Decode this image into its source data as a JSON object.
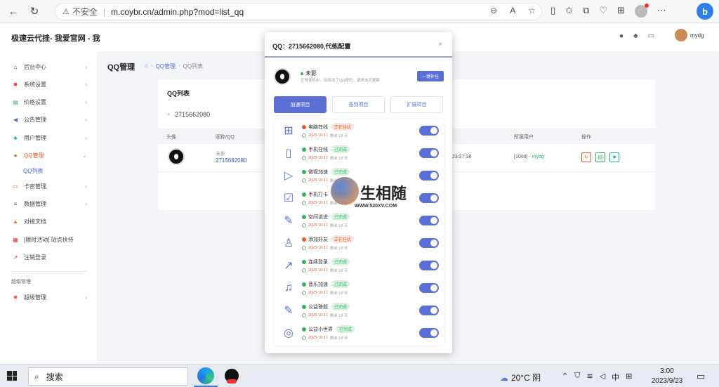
{
  "browser": {
    "insecure_label": "不安全",
    "url": "m.coybr.cn/admin.php?mod=list_qq"
  },
  "app": {
    "brand": "极速云代挂- 我爱官网 - 我",
    "user_name": "mydg"
  },
  "sidebar": {
    "items": [
      {
        "label": "后台中心"
      },
      {
        "label": "系统设置"
      },
      {
        "label": "价格设置"
      },
      {
        "label": "公告管理"
      },
      {
        "label": "用户管理"
      },
      {
        "label": "QQ管理"
      },
      {
        "label": "卡密管理"
      },
      {
        "label": "数据管理"
      },
      {
        "label": "对接文档"
      },
      {
        "label": "[限时活动] 站点扶持"
      },
      {
        "label": "注销登录"
      }
    ],
    "sub_item": "QQ列表",
    "group_label": "超级管理",
    "super_item": "超级管理"
  },
  "page": {
    "title": "QQ管理",
    "breadcrumb": [
      "QQ管理",
      "QQ列表"
    ]
  },
  "card": {
    "title": "QQ列表",
    "search_value": "2715662080",
    "columns": [
      "头像",
      "昵称/QQ",
      "所属用户",
      "操作"
    ],
    "row": {
      "nick": "未影",
      "qq": "2715662080",
      "time": "23:27:38",
      "owner_prefix": "[1000] - ",
      "owner": "mydg"
    }
  },
  "modal": {
    "title": "QQ：2715662080,代练配置",
    "nick": "未影",
    "note": "正常挂机中。如修改了QQ密码，请来本页更新",
    "quick_button": "一键补挂",
    "tabs": [
      "加速项目",
      "签到项目",
      "扩展项目"
    ],
    "tasks": [
      {
        "name": "电脑在线",
        "status": "正在挂机",
        "state": "run",
        "date": "2023-10-11",
        "remain": "剩余 18 天"
      },
      {
        "name": "手机在线",
        "status": "已完成",
        "state": "done",
        "date": "2023-10-11",
        "remain": "剩余 18 天"
      },
      {
        "name": "微视加速",
        "status": "已完成",
        "state": "done",
        "date": "2023-10-11",
        "remain": "剩余 18 天"
      },
      {
        "name": "手机打卡",
        "status": "已完成",
        "state": "done",
        "date": "2023-10-11",
        "remain": "剩余 18 天"
      },
      {
        "name": "空间说说",
        "status": "已完成",
        "state": "done",
        "date": "2023-10-11",
        "remain": "剩余 18 天"
      },
      {
        "name": "添加好友",
        "status": "正在挂机",
        "state": "run",
        "date": "2023-10-11",
        "remain": "剩余 18 天"
      },
      {
        "name": "连续登录",
        "status": "已完成",
        "state": "done",
        "date": "2023-10-11",
        "remain": "剩余 18 天"
      },
      {
        "name": "音乐加速",
        "status": "已完成",
        "state": "done",
        "date": "2023-10-11",
        "remain": "剩余 18 天"
      },
      {
        "name": "公益答题",
        "status": "已完成",
        "state": "done",
        "date": "2023-10-11",
        "remain": "剩余 18 天"
      },
      {
        "name": "公益小世界",
        "status": "已完成",
        "state": "done",
        "date": "2023-10-11",
        "remain": "剩余 18 天"
      }
    ]
  },
  "watermark": {
    "text": "生相随",
    "url": "WWW.520XV.COM"
  },
  "taskbar": {
    "search_label": "搜索",
    "weather": "20°C 阴",
    "ime": "中",
    "time": "3:00",
    "date": "2023/9/23"
  },
  "colors": {
    "accent": "#5a6fd6",
    "running": "#e5592b",
    "done": "#2db55d"
  }
}
